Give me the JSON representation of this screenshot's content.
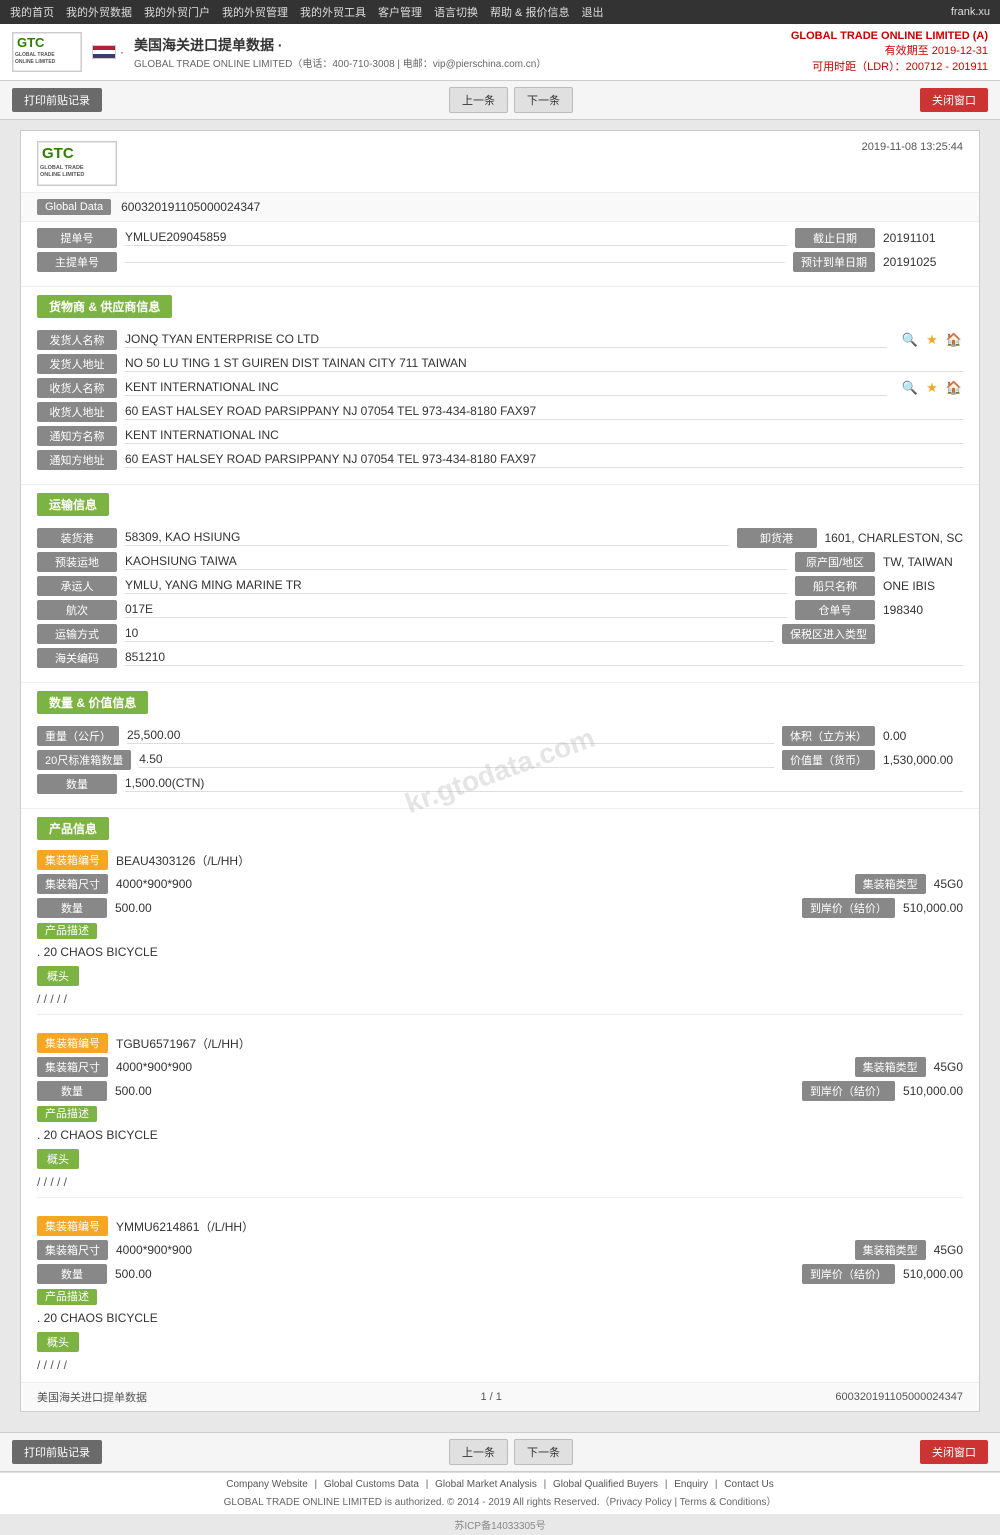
{
  "topnav": {
    "items": [
      "我的首页",
      "我的外贸数据",
      "我的外贸门户",
      "我的外贸管理",
      "我的外贸工具",
      "客户管理",
      "语言切换",
      "帮助 & 报价信息",
      "退出"
    ],
    "user": "frank.xu"
  },
  "header": {
    "logo_text": "GTC\nGLOBAL TRADE\nONLINE LIMITED",
    "flag_label": "USA",
    "title": "美国海关进口提单数据 ·",
    "subtitle": "GLOBAL TRADE ONLINE LIMITED（电话：400-710-3008 | 电邮：vip@pierschina.com.cn）",
    "company": "GLOBAL TRADE ONLINE LIMITED (A)",
    "valid_until": "有效期至 2019-12-31",
    "ldr": "可用时距（LDR）：200712 - 201911"
  },
  "toolbar": {
    "print_label": "打印前贴记录",
    "prev_label": "上一条",
    "next_label": "下一条",
    "close_label": "关闭窗口"
  },
  "doc": {
    "timestamp": "2019-11-08 13:25:44",
    "global_data_label": "Global Data",
    "global_data_value": "600320191105000024347",
    "fields": {
      "bill_no_label": "提单号",
      "bill_no_value": "YMLUE209045859",
      "cutoff_label": "截止日期",
      "cutoff_value": "20191101",
      "master_bill_label": "主提单号",
      "master_bill_value": "",
      "eta_label": "预计到单日期",
      "eta_value": "20191025"
    },
    "supplier_section": "货物商 & 供应商信息",
    "shipper_name_label": "发货人名称",
    "shipper_name_value": "JONQ TYAN ENTERPRISE CO LTD",
    "shipper_addr_label": "发货人地址",
    "shipper_addr_value": "NO 50 LU TING 1 ST GUIREN DIST TAINAN CITY 711 TAIWAN",
    "consignee_name_label": "收货人名称",
    "consignee_name_value": "KENT INTERNATIONAL INC",
    "consignee_addr_label": "收货人地址",
    "consignee_addr_value": "60 EAST HALSEY ROAD PARSIPPANY NJ 07054 TEL 973-434-8180 FAX97",
    "notify_name_label": "通知方名称",
    "notify_name_value": "KENT INTERNATIONAL INC",
    "notify_addr_label": "通知方地址",
    "notify_addr_value": "60 EAST HALSEY ROAD PARSIPPANY NJ 07054 TEL 973-434-8180 FAX97",
    "transport_section": "运输信息",
    "load_port_label": "装货港",
    "load_port_value": "58309, KAO HSIUNG",
    "unload_port_label": "卸货港",
    "unload_port_value": "1601, CHARLESTON, SC",
    "estimated_dest_label": "预装运地",
    "estimated_dest_value": "KAOHSIUNG TAIWA",
    "origin_label": "原产国/地区",
    "origin_value": "TW, TAIWAN",
    "carrier_label": "承运人",
    "carrier_value": "YMLU, YANG MING MARINE TR",
    "vessel_label": "船只名称",
    "vessel_value": "ONE IBIS",
    "voyage_label": "航次",
    "voyage_value": "017E",
    "bill_ref_label": "仓单号",
    "bill_ref_value": "198340",
    "transport_mode_label": "运输方式",
    "transport_mode_value": "10",
    "bonded_label": "保税区进入类型",
    "bonded_value": "",
    "customs_label": "海关编码",
    "customs_value": "851210",
    "quantity_section": "数量 & 价值信息",
    "weight_label": "重量（公斤）",
    "weight_value": "25,500.00",
    "volume_label": "体积（立方米）",
    "volume_value": "0.00",
    "container20_label": "20尺标准箱数量",
    "container20_value": "4.50",
    "amount_label": "价值量（货币）",
    "amount_value": "1,530,000.00",
    "quantity_label": "数量",
    "quantity_value": "1,500.00(CTN)",
    "product_section": "产品信息",
    "containers": [
      {
        "container_no_label": "集装箱编号",
        "container_no_value": "BEAU4303126（/L/HH）",
        "container_size_label": "集装箱尺寸",
        "container_size_value": "4000*900*900",
        "container_type_label": "集装箱类型",
        "container_type_value": "45G0",
        "quantity_label": "数量",
        "quantity_value": "500.00",
        "price_label": "到岸价（结价）",
        "price_value": "510,000.00",
        "desc_label": "产品描述",
        "desc_value": ". 20 CHAOS BICYCLE",
        "anchor_label": "概头",
        "slash_value": "/ / / / /"
      },
      {
        "container_no_label": "集装箱编号",
        "container_no_value": "TGBU6571967（/L/HH）",
        "container_size_label": "集装箱尺寸",
        "container_size_value": "4000*900*900",
        "container_type_label": "集装箱类型",
        "container_type_value": "45G0",
        "quantity_label": "数量",
        "quantity_value": "500.00",
        "price_label": "到岸价（结价）",
        "price_value": "510,000.00",
        "desc_label": "产品描述",
        "desc_value": ". 20 CHAOS BICYCLE",
        "anchor_label": "概头",
        "slash_value": "/ / / / /"
      },
      {
        "container_no_label": "集装箱编号",
        "container_no_value": "YMMU6214861（/L/HH）",
        "container_size_label": "集装箱尺寸",
        "container_size_value": "4000*900*900",
        "container_type_label": "集装箱类型",
        "container_type_value": "45G0",
        "quantity_label": "数量",
        "quantity_value": "500.00",
        "price_label": "到岸价（结价）",
        "price_value": "510,000.00",
        "desc_label": "产品描述",
        "desc_value": ". 20 CHAOS BICYCLE",
        "anchor_label": "概头",
        "slash_value": "/ / / / /"
      }
    ],
    "footer_left": "美国海关进口提单数据",
    "footer_page": "1 / 1",
    "footer_id": "600320191105000024347"
  },
  "footer_links": [
    "Company Website",
    "Global Customs Data",
    "Global Market Analysis",
    "Global Qualified Buyers",
    "Enquiry",
    "Contact Us"
  ],
  "footer_copy": "GLOBAL TRADE ONLINE LIMITED is authorized. © 2014 - 2019 All rights Reserved.（Privacy Policy | Terms & Conditions）",
  "icp": "苏ICP备14033305号",
  "watermark": "kr.gtodata.com"
}
